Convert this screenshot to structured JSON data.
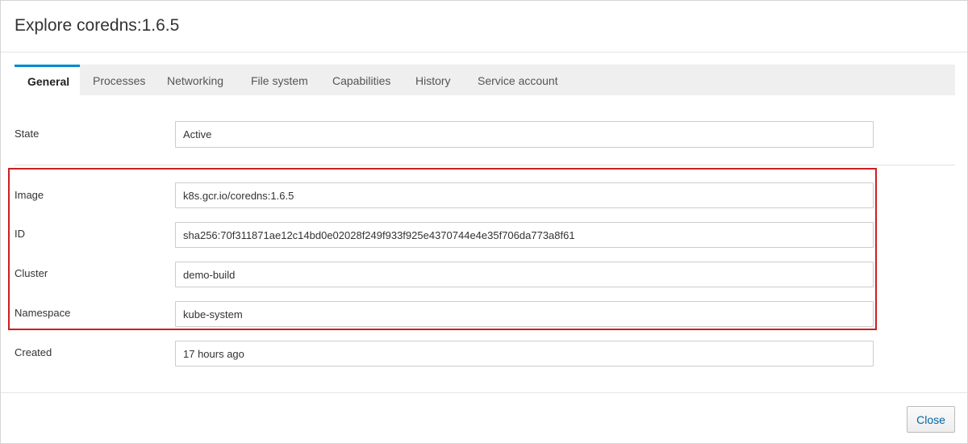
{
  "dialog": {
    "title": "Explore coredns:1.6.5"
  },
  "tabs": [
    {
      "label": "General",
      "active": true
    },
    {
      "label": "Processes",
      "active": false
    },
    {
      "label": "Networking",
      "active": false
    },
    {
      "label": "File system",
      "active": false
    },
    {
      "label": "Capabilities",
      "active": false
    },
    {
      "label": "History",
      "active": false
    },
    {
      "label": "Service account",
      "active": false
    }
  ],
  "fields": {
    "state": {
      "label": "State",
      "value": "Active"
    },
    "image": {
      "label": "Image",
      "value": "k8s.gcr.io/coredns:1.6.5"
    },
    "id": {
      "label": "ID",
      "value": "sha256:70f311871ae12c14bd0e02028f249f933f925e4370744e4e35f706da773a8f61"
    },
    "cluster": {
      "label": "Cluster",
      "value": "demo-build"
    },
    "namespace": {
      "label": "Namespace",
      "value": "kube-system"
    },
    "created": {
      "label": "Created",
      "value": "17 hours ago"
    }
  },
  "footer": {
    "close_label": "Close"
  },
  "colors": {
    "active_tab_accent": "#0088ce",
    "highlight_border": "#cc1f1f",
    "link_text": "#0066aa"
  }
}
